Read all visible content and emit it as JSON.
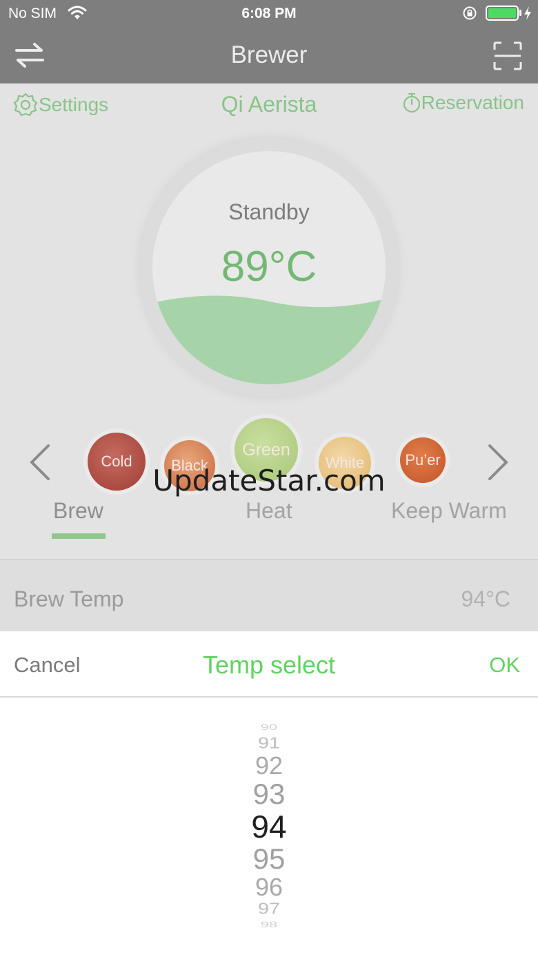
{
  "status_bar": {
    "carrier": "No SIM",
    "time": "6:08 PM",
    "battery_color": "#4cd964"
  },
  "nav": {
    "title": "Brewer",
    "left_icon": "swap-icon",
    "right_icon": "scan-icon"
  },
  "subbar": {
    "settings_label": "Settings",
    "device_name": "Qi Aerista",
    "reservation_label": "Reservation"
  },
  "dial": {
    "status": "Standby",
    "temperature": "89°C",
    "accent_color": "#73b873"
  },
  "teas": [
    {
      "label": "Cold"
    },
    {
      "label": "Black"
    },
    {
      "label": "Green"
    },
    {
      "label": "White"
    },
    {
      "label": "Pu’er"
    }
  ],
  "watermark": "UpdateStar.com",
  "modes": {
    "brew": "Brew",
    "heat": "Heat",
    "keep_warm": "Keep Warm",
    "selected": "Brew"
  },
  "brew_temp": {
    "label": "Brew Temp",
    "value": "94°C"
  },
  "picker": {
    "cancel": "Cancel",
    "title": "Temp select",
    "ok": "OK",
    "accent_color": "#5fd35f",
    "options": [
      "90",
      "91",
      "92",
      "93",
      "94",
      "95",
      "96",
      "97",
      "98"
    ],
    "selected": "94"
  }
}
